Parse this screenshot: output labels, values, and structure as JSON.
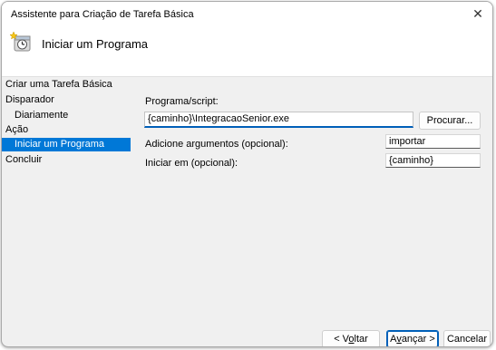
{
  "window": {
    "title": "Assistente para Criação de Tarefa Básica",
    "close_glyph": "✕"
  },
  "header": {
    "heading": "Iniciar um Programa",
    "icon": "task-clock-icon"
  },
  "sidebar": {
    "items": [
      {
        "label": "Criar uma Tarefa Básica"
      },
      {
        "label": "Disparador"
      },
      {
        "label": "Diariamente"
      },
      {
        "label": "Ação"
      },
      {
        "label": "Iniciar um Programa"
      },
      {
        "label": "Concluir"
      }
    ]
  },
  "form": {
    "program_label": "Programa/script:",
    "program_value": "{caminho}\\IntegracaoSenior.exe",
    "browse_button": "Procurar...",
    "args_label": "Adicione argumentos (opcional):",
    "args_value": "importar",
    "startin_label": "Iniciar em (opcional):",
    "startin_value": "{caminho}"
  },
  "footer": {
    "back_prefix": "< V",
    "back_accel": "o",
    "back_suffix": "ltar",
    "next_prefix": "A",
    "next_accel": "v",
    "next_suffix": "ançar >",
    "cancel_label": "Cancelar"
  },
  "colors": {
    "selection": "#0078d7",
    "accent": "#005fb8"
  }
}
